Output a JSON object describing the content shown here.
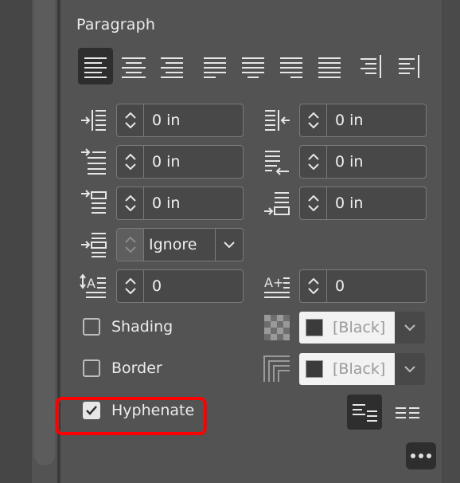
{
  "panel": {
    "title": "Paragraph"
  },
  "alignment": {
    "buttons": [
      {
        "name": "align-left-icon",
        "active": true
      },
      {
        "name": "align-center-icon",
        "active": false
      },
      {
        "name": "align-right-icon",
        "active": false
      },
      {
        "name": "justify-left-icon",
        "active": false
      },
      {
        "name": "justify-center-icon",
        "active": false
      },
      {
        "name": "justify-right-icon",
        "active": false
      },
      {
        "name": "justify-all-icon",
        "active": false
      },
      {
        "name": "align-toward-spine-icon",
        "active": false
      },
      {
        "name": "align-away-from-spine-icon",
        "active": false
      }
    ]
  },
  "fields": {
    "left_indent": "0 in",
    "right_indent": "0 in",
    "first_line_indent": "0 in",
    "last_line_indent": "0 in",
    "space_before": "0 in",
    "space_after": "0 in",
    "align_to_grid": "Ignore",
    "drop_cap_lines": "0",
    "drop_cap_characters": "0"
  },
  "shading": {
    "label": "Shading",
    "checked": false,
    "color": "[Black]"
  },
  "border": {
    "label": "Border",
    "checked": false,
    "color": "[Black]"
  },
  "hyphenate": {
    "label": "Hyphenate",
    "checked": true
  },
  "colors": {
    "highlight": "#ff0000",
    "panel_bg": "#535353",
    "active_btn": "#2e2e2e"
  }
}
